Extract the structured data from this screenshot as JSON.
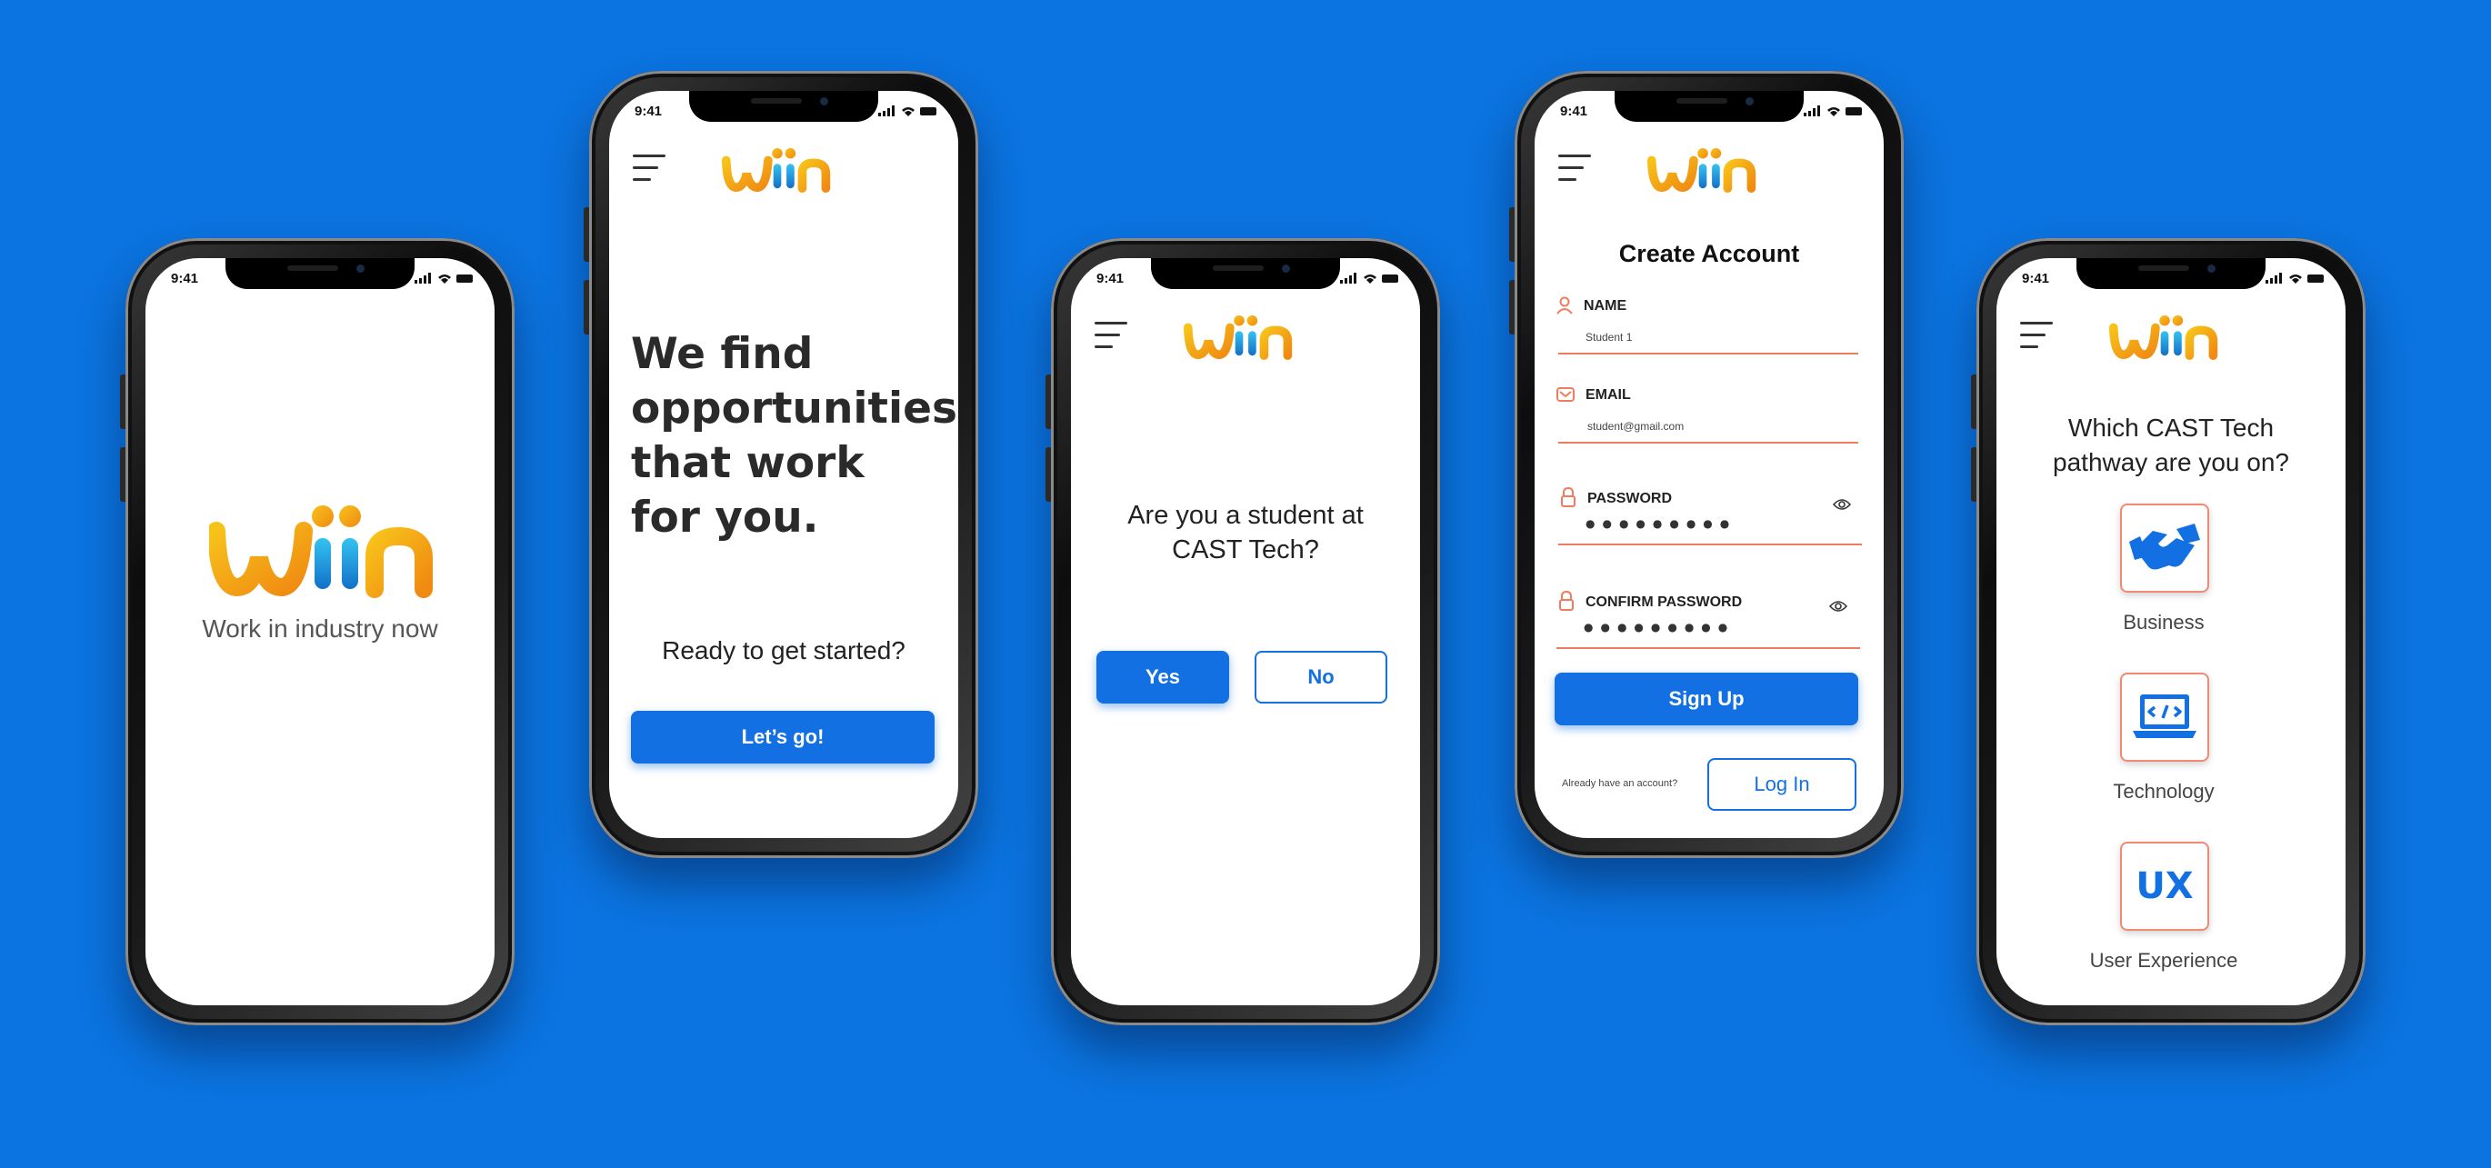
{
  "status_time": "9:41",
  "brand": {
    "logo_text": "wiin",
    "tagline": "Work in industry now",
    "colors": {
      "orange": "#f39a12",
      "yellow": "#f7c21a",
      "blue": "#1b9ee0",
      "primary": "#1270e3",
      "accent": "#f07c5f",
      "background": "#0b74e0"
    }
  },
  "screen2": {
    "headline": "We find opportunities that work for you.",
    "prompt": "Ready to get started?",
    "cta_label": "Let’s go!"
  },
  "screen3": {
    "question": "Are you a student at CAST Tech?",
    "yes_label": "Yes",
    "no_label": "No"
  },
  "screen4": {
    "title": "Create Account",
    "name_label": "NAME",
    "name_value": "Student 1",
    "email_label": "EMAIL",
    "email_value": "student@gmail.com",
    "password_label": "PASSWORD",
    "password_value": "●●●●●●●●●",
    "confirm_label": "CONFIRM PASSWORD",
    "confirm_value": "●●●●●●●●●",
    "signup_label": "Sign Up",
    "already_text": "Already have an account?",
    "login_label": "Log In"
  },
  "screen5": {
    "question": "Which CAST Tech pathway are you on?",
    "pathways": [
      {
        "label": "Business",
        "icon": "handshake-icon"
      },
      {
        "label": "Technology",
        "icon": "laptop-code-icon"
      },
      {
        "label": "User Experience",
        "icon": "ux-icon",
        "icon_text": "UX"
      }
    ]
  }
}
